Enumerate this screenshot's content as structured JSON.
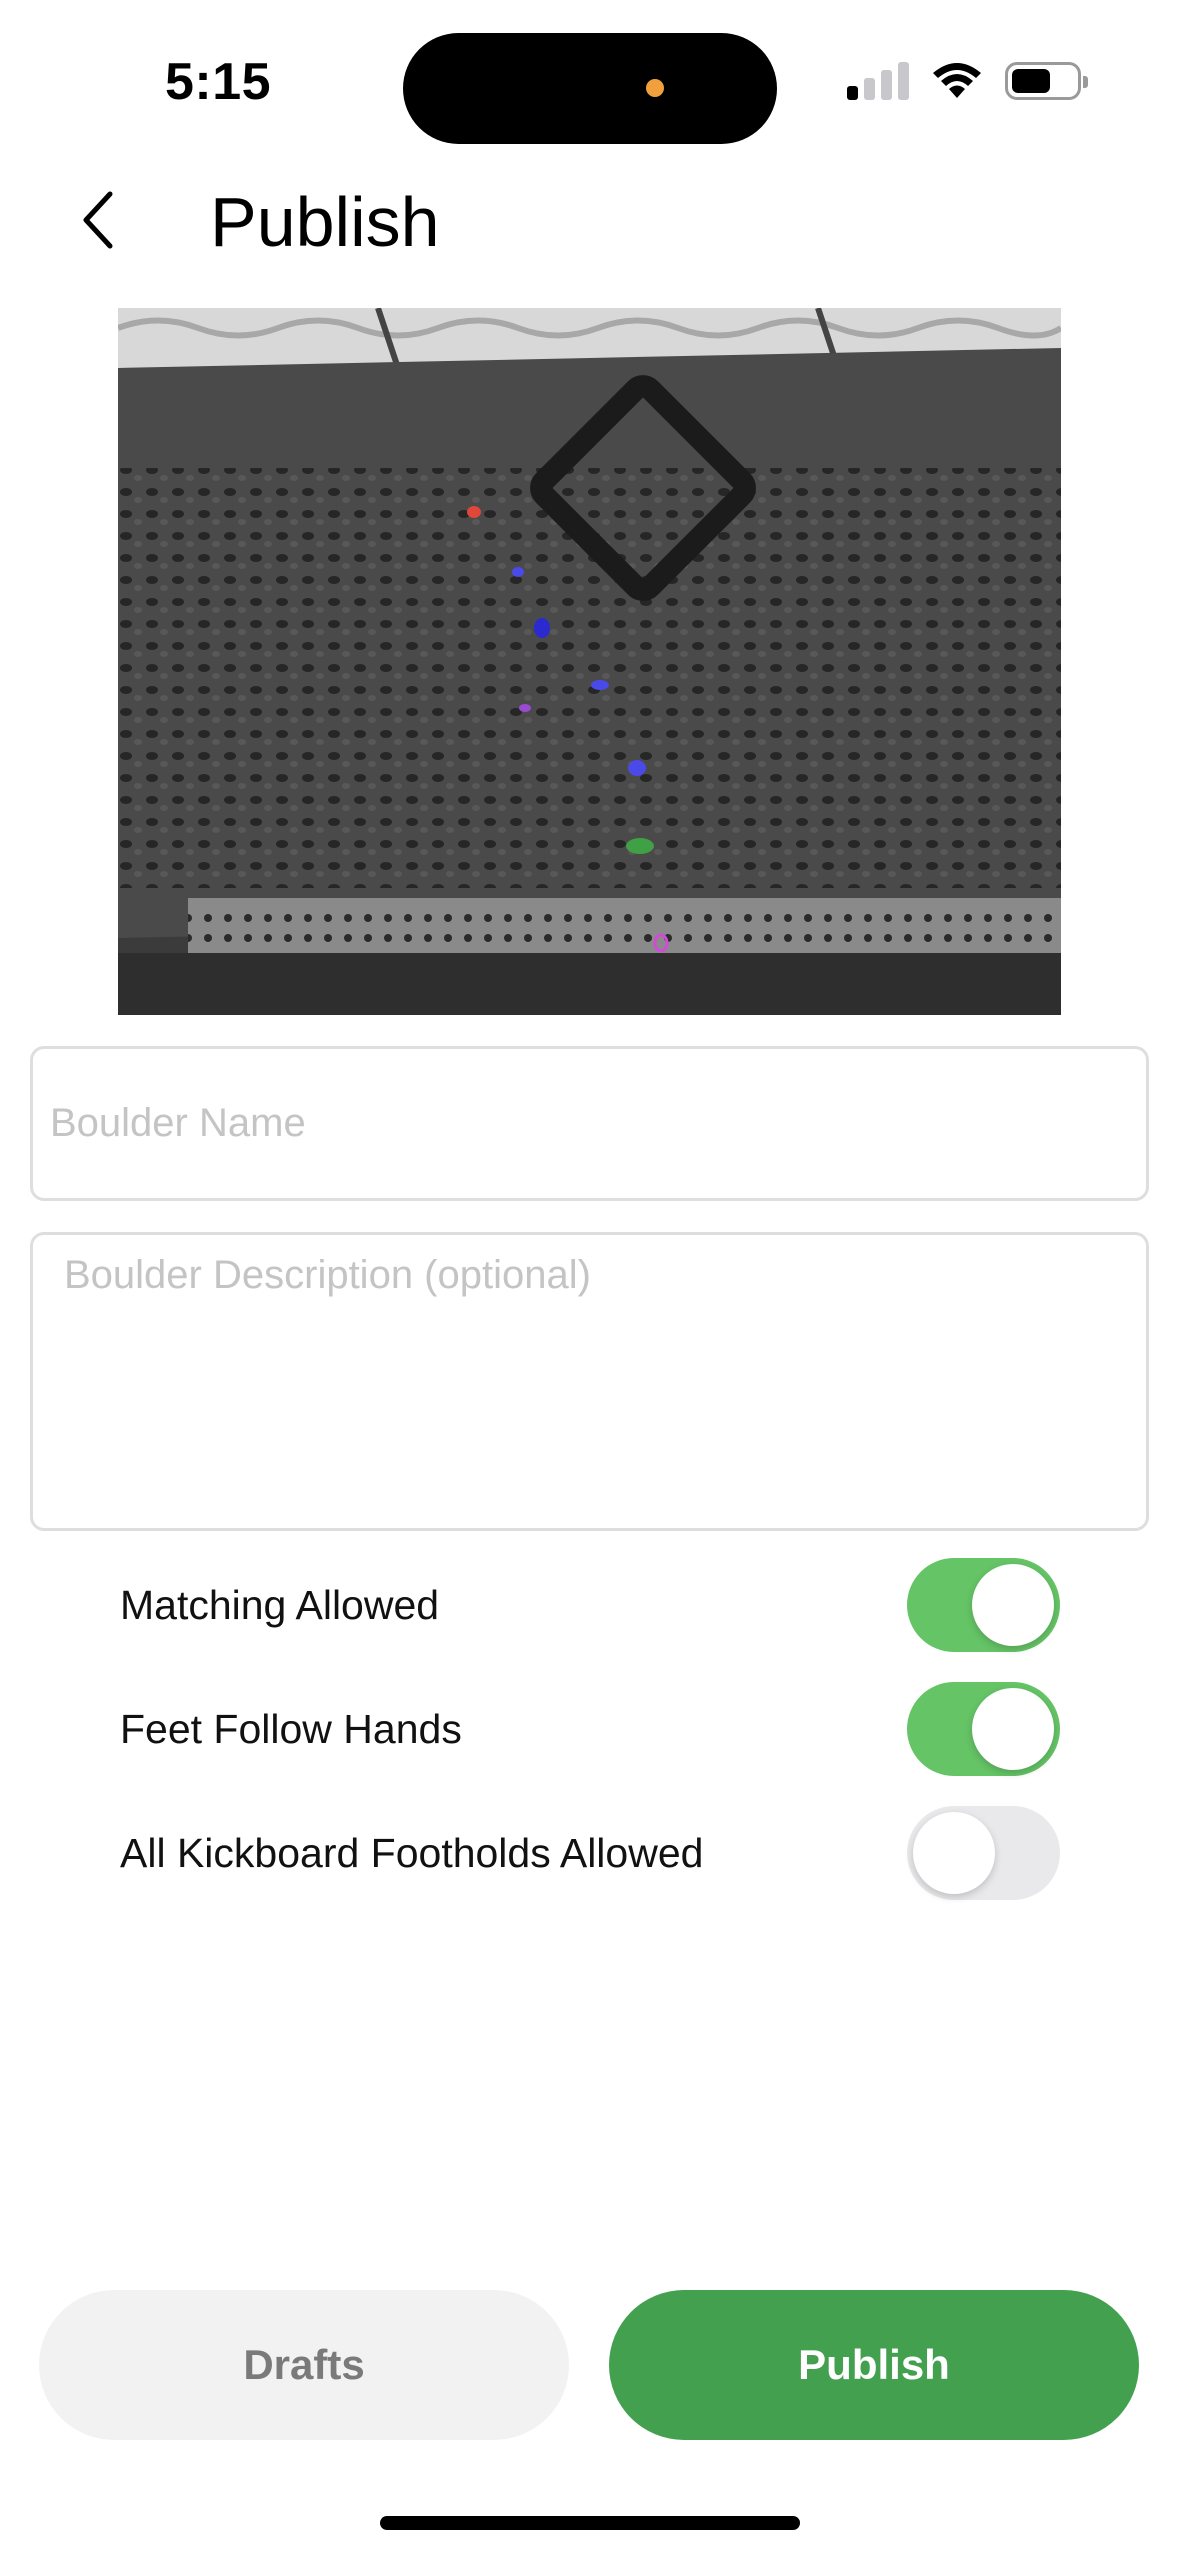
{
  "status_bar": {
    "time": "5:15",
    "icons": [
      "signal-icon",
      "wifi-icon",
      "battery-icon"
    ]
  },
  "header": {
    "back_icon": "chevron-left-icon",
    "title": "Publish"
  },
  "wall_image": {
    "hold_colors": [
      "#e0463a",
      "#4a4ae8",
      "#9a4ad0",
      "#3fa046",
      "#d24ad8"
    ]
  },
  "form": {
    "name_placeholder": "Boulder Name",
    "name_value": "",
    "description_placeholder": "Boulder Description (optional)",
    "description_value": ""
  },
  "toggles": [
    {
      "label": "Matching Allowed",
      "on": true
    },
    {
      "label": "Feet Follow Hands",
      "on": true
    },
    {
      "label": "All Kickboard Footholds Allowed",
      "on": false
    }
  ],
  "buttons": {
    "drafts": "Drafts",
    "publish": "Publish"
  },
  "colors": {
    "accent": "#43a04f",
    "toggle_on": "#65c466",
    "toggle_off": "#e9e9eb"
  }
}
